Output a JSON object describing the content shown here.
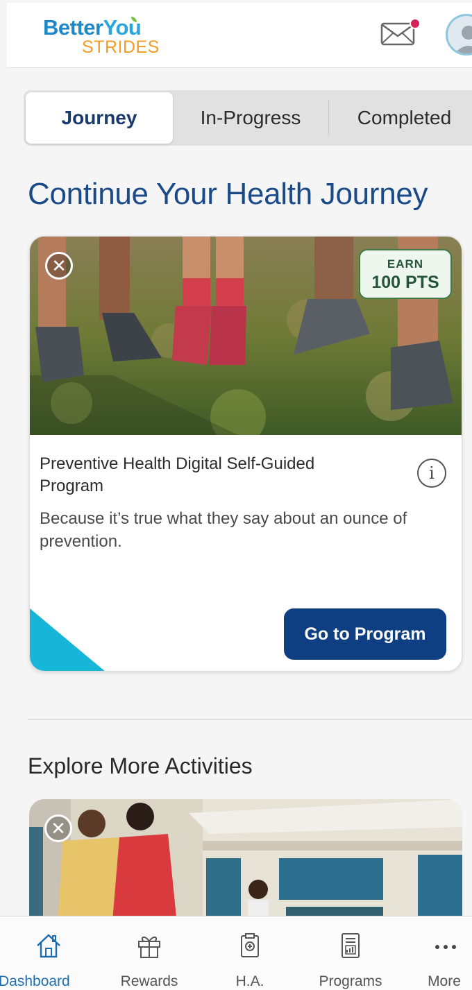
{
  "header": {
    "logo_part1": "Better",
    "logo_part2": "Yo",
    "logo_part3": "u",
    "logo_sub": "STRIDES",
    "notification_dot_color": "#d6245a"
  },
  "tabs": [
    {
      "label": "Journey",
      "active": true
    },
    {
      "label": "In-Progress",
      "active": false
    },
    {
      "label": "Completed",
      "active": false
    }
  ],
  "main": {
    "title": "Continue Your Health Journey",
    "card": {
      "badge_top": "EARN",
      "badge_bottom": "100 PTS",
      "title": "Preventive Health Digital Self-Guided Program",
      "description": "Because it’s true what they say about an ounce of prevention.",
      "button_label": "Go to Program"
    },
    "section_title": "Explore More Activities"
  },
  "bottom_nav": [
    {
      "label": "Dashboard",
      "icon": "home-icon",
      "active": true
    },
    {
      "label": "Rewards",
      "icon": "gift-icon",
      "active": false
    },
    {
      "label": "H.A.",
      "icon": "health-assessment-icon",
      "active": false
    },
    {
      "label": "Programs",
      "icon": "programs-icon",
      "active": false
    },
    {
      "label": "More",
      "icon": "more-icon",
      "active": false
    }
  ],
  "colors": {
    "primary": "#0d3f82",
    "title": "#1a4a88",
    "accent_teal": "#17b6d9",
    "brand_orange": "#f39c26"
  }
}
